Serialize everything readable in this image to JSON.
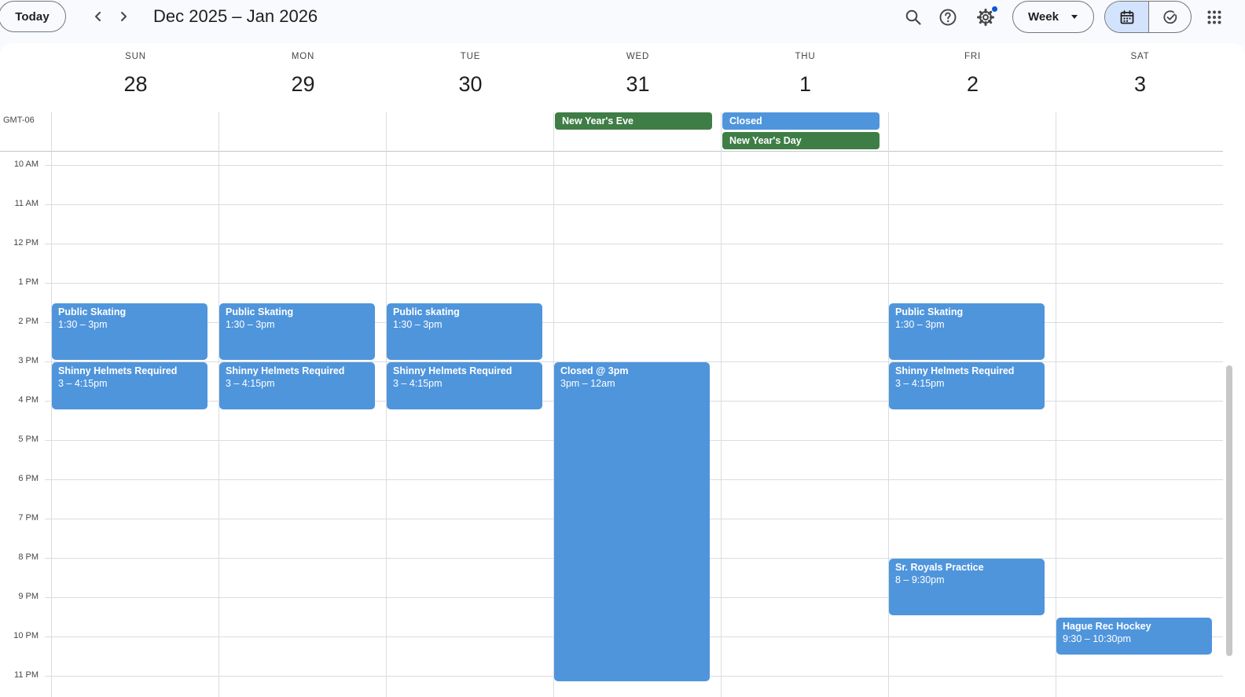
{
  "toolbar": {
    "today_label": "Today",
    "prev_icon": "chevron-left-icon",
    "next_icon": "chevron-right-icon",
    "date_range": "Dec 2025 – Jan 2026",
    "search_icon": "search-icon",
    "help_icon": "help-icon",
    "settings_icon": "gear-icon",
    "view_label": "Week",
    "calendar_mode_icon": "calendar-icon",
    "tasks_mode_icon": "task-check-icon",
    "apps_icon": "apps-grid-icon",
    "accent_color": "#0b57d0",
    "selected_mode_bg": "#d3e3fd"
  },
  "timezone": "GMT-06",
  "days": [
    {
      "dow": "SUN",
      "date": "28"
    },
    {
      "dow": "MON",
      "date": "29"
    },
    {
      "dow": "TUE",
      "date": "30"
    },
    {
      "dow": "WED",
      "date": "31"
    },
    {
      "dow": "THU",
      "date": "1"
    },
    {
      "dow": "FRI",
      "date": "2"
    },
    {
      "dow": "SAT",
      "date": "3"
    }
  ],
  "hours": [
    "10 AM",
    "11 AM",
    "12 PM",
    "1 PM",
    "2 PM",
    "3 PM",
    "4 PM",
    "5 PM",
    "6 PM",
    "7 PM",
    "8 PM",
    "9 PM",
    "10 PM",
    "11 PM"
  ],
  "event_colors": {
    "blue": "#4f95dc",
    "green": "#3f7d46"
  },
  "allday_events": [
    {
      "title": "New Year's Eve",
      "color": "#3f7d46",
      "day": 3,
      "row": 0
    },
    {
      "title": "Closed",
      "color": "#4f95dc",
      "day": 4,
      "row": 0
    },
    {
      "title": "New Year's Day",
      "color": "#3f7d46",
      "day": 4,
      "row": 1
    }
  ],
  "events": [
    {
      "title": "Public Skating",
      "time": "1:30 – 3pm",
      "day": 0,
      "start": 13.5,
      "end": 15
    },
    {
      "title": "Shinny Helmets Required",
      "time": "3 – 4:15pm",
      "day": 0,
      "start": 15,
      "end": 16.25
    },
    {
      "title": "Public Skating",
      "time": "1:30 – 3pm",
      "day": 1,
      "start": 13.5,
      "end": 15
    },
    {
      "title": "Shinny Helmets Required",
      "time": "3 – 4:15pm",
      "day": 1,
      "start": 15,
      "end": 16.25
    },
    {
      "title": "Public skating",
      "time": "1:30 – 3pm",
      "day": 2,
      "start": 13.5,
      "end": 15
    },
    {
      "title": "Shinny Helmets Required",
      "time": "3 – 4:15pm",
      "day": 2,
      "start": 15,
      "end": 16.25
    },
    {
      "title": "Closed @ 3pm",
      "time": "3pm – 12am",
      "day": 3,
      "start": 15,
      "end": 24
    },
    {
      "title": "Public Skating",
      "time": "1:30 – 3pm",
      "day": 5,
      "start": 13.5,
      "end": 15
    },
    {
      "title": "Shinny Helmets Required",
      "time": "3 – 4:15pm",
      "day": 5,
      "start": 15,
      "end": 16.25
    },
    {
      "title": "Sr. Royals Practice",
      "time": "8 – 9:30pm",
      "day": 5,
      "start": 20,
      "end": 21.5
    },
    {
      "title": "Hague Rec Hockey",
      "time": "9:30 – 10:30pm",
      "day": 6,
      "start": 21.5,
      "end": 22.5
    }
  ]
}
